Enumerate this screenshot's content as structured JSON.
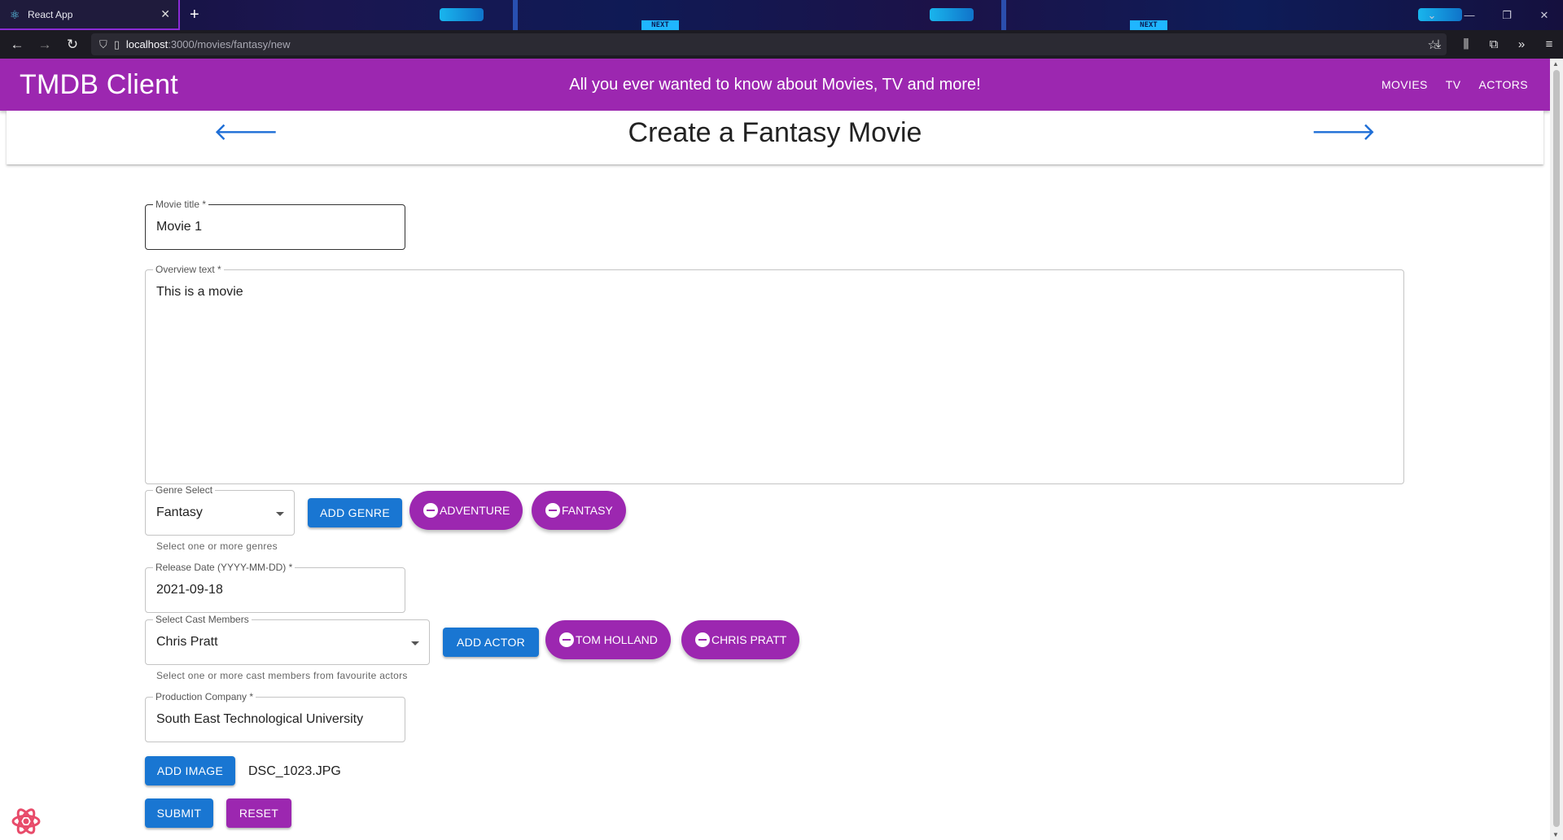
{
  "browser": {
    "tab_title": "React App",
    "tab_close": "✕",
    "new_tab": "+",
    "url_host": "localhost",
    "url_path": ":3000/movies/fantasy/new",
    "decor_next": "NEXT"
  },
  "app": {
    "brand": "TMDB Client",
    "tagline": "All you ever wanted to know about Movies, TV and more!",
    "menu": [
      {
        "label": "MOVIES"
      },
      {
        "label": "TV"
      },
      {
        "label": "ACTORS"
      }
    ]
  },
  "header": {
    "title": "Create a Fantasy Movie"
  },
  "form": {
    "title_field": {
      "label": "Movie title *",
      "value": "Movie 1"
    },
    "overview_field": {
      "label": "Overview text *",
      "value": "This is a movie"
    },
    "genre_select": {
      "label": "Genre Select",
      "value": "Fantasy",
      "helper": "Select one or more genres"
    },
    "add_genre_button": "ADD GENRE",
    "genre_chips": [
      {
        "label": "ADVENTURE"
      },
      {
        "label": "FANTASY"
      }
    ],
    "release_date": {
      "label": "Release Date (YYYY-MM-DD) *",
      "value": "2021-09-18"
    },
    "cast_select": {
      "label": "Select Cast Members",
      "value": "Chris Pratt",
      "helper": "Select one or more cast members from favourite actors"
    },
    "add_actor_button": "ADD ACTOR",
    "cast_chips": [
      {
        "label": "TOM HOLLAND"
      },
      {
        "label": "CHRIS PRATT"
      }
    ],
    "production_company": {
      "label": "Production Company *",
      "value": "South East Technological University"
    },
    "add_image_button": "ADD IMAGE",
    "image_filename": "DSC_1023.JPG",
    "submit_button": "SUBMIT",
    "reset_button": "RESET"
  },
  "colors": {
    "primary_purple": "#9c27b0",
    "primary_blue": "#1976d2"
  }
}
